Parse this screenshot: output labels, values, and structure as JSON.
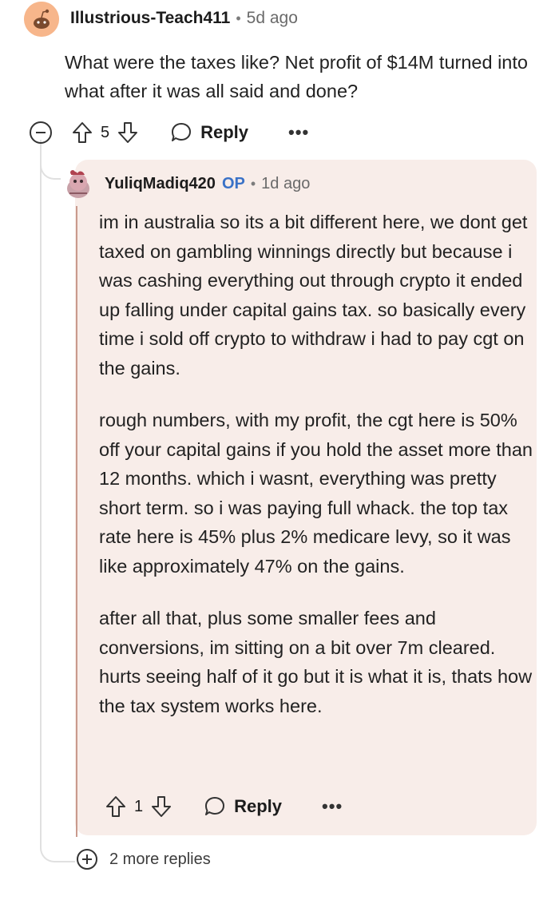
{
  "comment": {
    "username": "Illustrious-Teach411",
    "age": "5d ago",
    "body": "What were the taxes like? Net profit of $14M turned into what after it was all said and done?",
    "votes": "5",
    "reply_label": "Reply",
    "more_label": "•••"
  },
  "reply": {
    "username": "YuliqMadiq420",
    "op_tag": "OP",
    "age": "1d ago",
    "paragraphs": [
      "im in australia so its a bit different here, we dont get taxed on gambling winnings directly but because i was cashing everything out through crypto it ended up falling under capital gains tax. so basically every time i sold off crypto to withdraw i had to pay cgt on the gains.",
      "rough numbers, with my profit, the cgt here is 50% off your capital gains if you hold the asset more than 12 months. which i wasnt, everything was pretty short term. so i was paying full whack. the top tax rate here is 45% plus 2% medicare levy, so it was like approximately 47% on the gains.",
      "after all that, plus some smaller fees and conversions, im sitting on a bit over 7m cleared. hurts seeing half of it go but it is what it is, thats how the tax system works here."
    ],
    "votes": "1",
    "reply_label": "Reply",
    "more_label": "•••"
  },
  "more_replies": {
    "label": "2 more replies"
  },
  "colors": {
    "reply_background": "#f8ede9",
    "op_tag": "#3a72c7",
    "avatar1_bg": "#f7b68b"
  }
}
